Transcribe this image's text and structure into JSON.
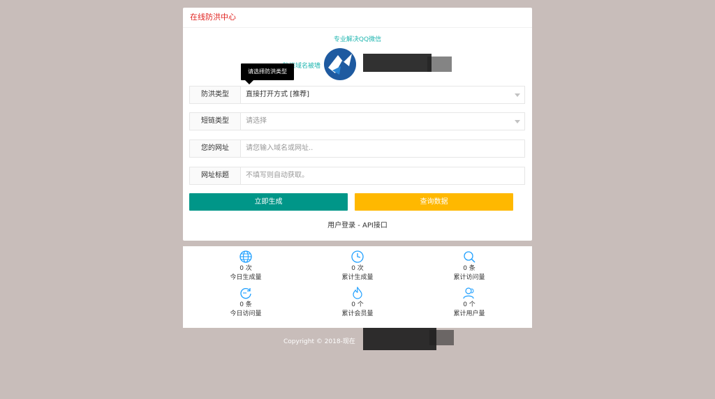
{
  "header": {
    "title": "在线防洪中心"
  },
  "promo": {
    "text": "专业解决QQ微信",
    "domain_label": "防洪域名被墙"
  },
  "tooltip": {
    "text": "请选择防洪类型"
  },
  "form": {
    "type": {
      "label": "防洪类型",
      "value": "直接打开方式 [推荐]"
    },
    "shortlink": {
      "label": "短链类型",
      "placeholder": "请选择"
    },
    "url": {
      "label": "您的网址",
      "placeholder": "请您输入域名或网址.."
    },
    "title": {
      "label": "网址标题",
      "placeholder": "不填写则自动获取。"
    }
  },
  "buttons": {
    "generate": "立即生成",
    "query": "查询数据"
  },
  "links": {
    "text": "用户登录 - API接口"
  },
  "stats": [
    {
      "icon": "globe-icon",
      "value": "0 次",
      "label": "今日生成量"
    },
    {
      "icon": "clock-icon",
      "value": "0 次",
      "label": "累计生成量"
    },
    {
      "icon": "search-icon",
      "value": "0 条",
      "label": "累计访问量"
    },
    {
      "icon": "refresh-icon",
      "value": "0 条",
      "label": "今日访问量"
    },
    {
      "icon": "fire-icon",
      "value": "0 个",
      "label": "累计会员量"
    },
    {
      "icon": "users-icon",
      "value": "0 个",
      "label": "累计用户量"
    }
  ],
  "footer": {
    "copyright": "Copyright © 2018-现在"
  },
  "colors": {
    "accent_teal": "#009688",
    "accent_yellow": "#ffb800",
    "title_red": "#e0221f",
    "icon_blue": "#1e9fff"
  }
}
